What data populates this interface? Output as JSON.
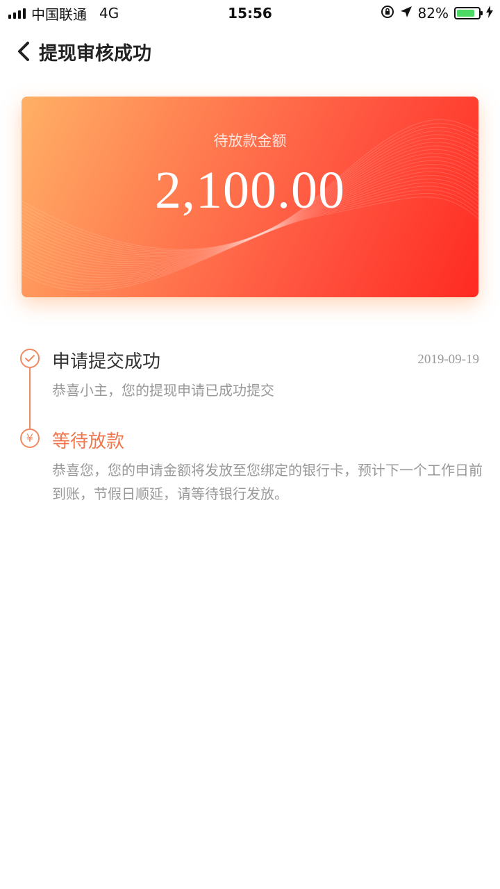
{
  "status_bar": {
    "carrier": "中国联通",
    "network": "4G",
    "time": "15:56",
    "battery_percent": "82%",
    "battery_level": 0.82
  },
  "nav": {
    "title": "提现审核成功"
  },
  "card": {
    "label": "待放款金额",
    "amount": "2,100.00"
  },
  "timeline": {
    "steps": [
      {
        "title": "申请提交成功",
        "date": "2019-09-19",
        "description": "恭喜小主，您的提现申请已成功提交",
        "icon": "check-icon"
      },
      {
        "title": "等待放款",
        "description": "恭喜您，您的申请金额将发放至您绑定的银行卡，预计下一个工作日前到账，节假日顺延，请等待银行发放。",
        "icon": "yen-icon"
      }
    ]
  },
  "colors": {
    "accent": "#f08a63",
    "accent_text": "#f0784f",
    "card_start": "#ffb066",
    "card_end": "#ff2a22",
    "muted_text": "#999999"
  }
}
